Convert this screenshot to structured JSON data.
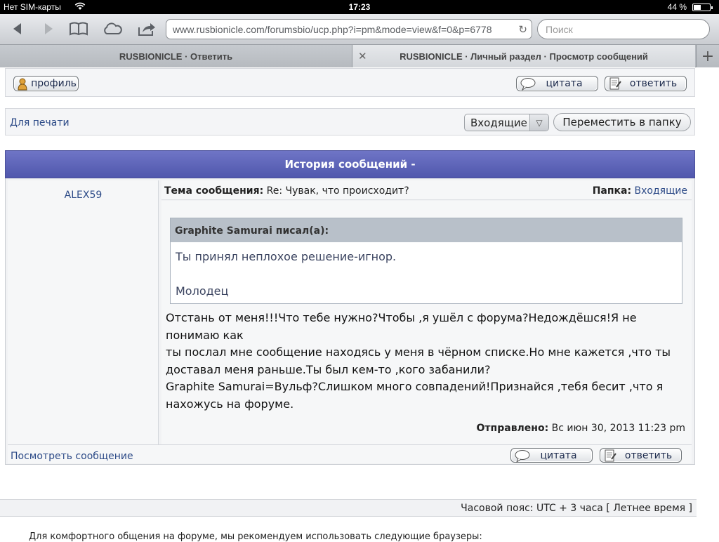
{
  "status": {
    "carrier": "Нет SIM-карты",
    "time": "17:23",
    "battery": "44 %",
    "battery_level": 0.44
  },
  "browser": {
    "url": "www.rusbionicle.com/forumsbio/ucp.php?i=pm&mode=view&f=0&p=6778",
    "search_placeholder": "Поиск",
    "tabs": [
      {
        "title": "RUSBIONICLE · Ответить"
      },
      {
        "title": "RUSBIONICLE · Личный раздел · Просмотр сообщений"
      }
    ]
  },
  "top_actions": {
    "profile": "профиль",
    "quote": "цитата",
    "reply": "ответить"
  },
  "tools": {
    "print": "Для печати",
    "folder_select": "Входящие",
    "move": "Переместить в папку"
  },
  "history": {
    "title": "История сообщений -",
    "author": "ALEX59",
    "subject_label": "Тема сообщения:",
    "subject": "Re: Чувак, что происходит?",
    "folder_label": "Папка:",
    "folder": "Входящие",
    "quote_header": "Graphite Samurai писал(а):",
    "quote_line1": "Ты принял неплохое решение-игнор.",
    "quote_line2": "Молодец",
    "body_lines": [
      "Отстань от меня!!!Что тебе нужно?Чтобы ,я ушёл с форума?Недождёшся!Я не понимаю как",
      "ты послал мне сообщение находясь у меня в чёрном списке.Но мне кажется ,что ты",
      "доставал меня раньше.Ты был кем-то ,кого забанили?",
      "Graphite Samurai=Вульф?Слишком много совпадений!Признайся ,тебя бесит ,что я",
      "нахожусь на форуме."
    ],
    "sent_label": "Отправлено:",
    "sent": "Вс июн 30, 2013 11:23 pm",
    "view_link": "Посмотреть сообщение",
    "quote_btn": "цитата",
    "reply_btn": "ответить"
  },
  "footer": {
    "timezone": "Часовой пояс: UTC + 3 часа [ Летнее время ]",
    "browsers_note": "Для комфортного общения на форуме, мы рекомендуем использовать следующие браузеры:"
  }
}
